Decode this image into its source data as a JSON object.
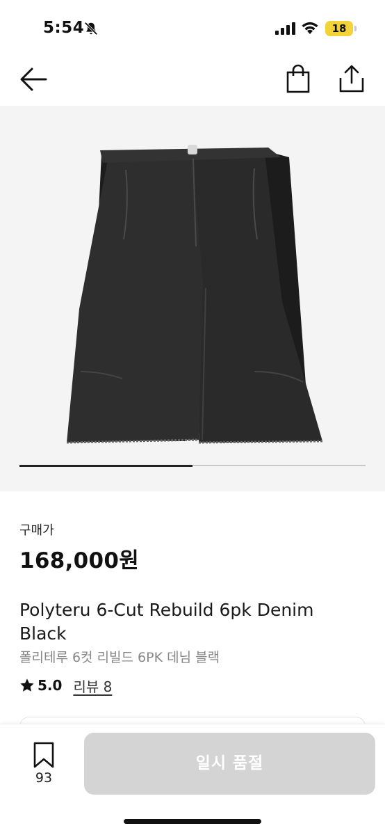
{
  "status": {
    "time": "5:54",
    "battery": "18"
  },
  "product": {
    "price_label": "구매가",
    "price": "168,000원",
    "title": "Polyteru 6-Cut Rebuild 6pk Denim Black",
    "subtitle": "폴리테루 6컷 리빌드 6PK 데님 블랙",
    "rating": "5.0",
    "review_label": "리뷰 8"
  },
  "gallery": {
    "progress": 0.5
  },
  "bottom": {
    "bookmark_count": "93",
    "buy_label": "일시 품절"
  },
  "icons": [
    "back-arrow-icon",
    "shopping-bag-icon",
    "share-icon",
    "bell-slash-icon",
    "signal-icon",
    "wifi-icon",
    "star-icon",
    "bookmark-icon"
  ],
  "colors": {
    "accent": "#111111",
    "disabled_button": "#d4d4d4",
    "battery": "#f2d338",
    "image_bg": "#f4f4f4"
  }
}
